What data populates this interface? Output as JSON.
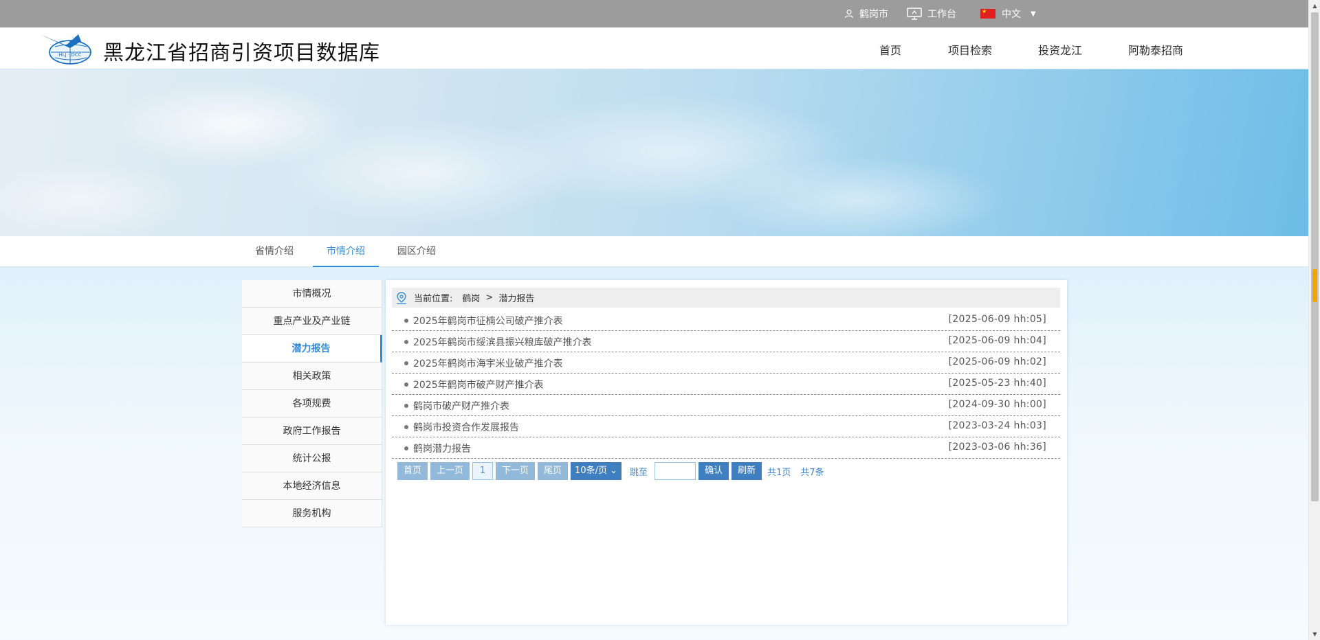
{
  "topbar": {
    "user_label": "鹤岗市",
    "workbench_label": "工作台",
    "language_label": "中文"
  },
  "header": {
    "site_title": "黑龙江省招商引资项目数据库",
    "logo_text": "HLJ · DCC",
    "nav": [
      "首页",
      "项目检索",
      "投资龙江",
      "阿勒泰招商"
    ]
  },
  "subtabs": [
    "省情介绍",
    "市情介绍",
    "园区介绍"
  ],
  "sidebar": {
    "items": [
      "市情概况",
      "重点产业及产业链",
      "潜力报告",
      "相关政策",
      "各项规费",
      "政府工作报告",
      "统计公报",
      "本地经济信息",
      "服务机构"
    ],
    "active": "潜力报告"
  },
  "breadcrumb": {
    "prefix": "当前位置:",
    "city": "鹤岗",
    "separator": ">",
    "page": "潜力报告"
  },
  "articles": [
    {
      "title": "2025年鹤岗市征楠公司破产推介表",
      "date": "[2025-06-09 hh:05]"
    },
    {
      "title": "2025年鹤岗市绥滨县振兴粮库破产推介表",
      "date": "[2025-06-09 hh:04]"
    },
    {
      "title": "2025年鹤岗市海宇米业破产推介表",
      "date": "[2025-06-09 hh:02]"
    },
    {
      "title": "2025年鹤岗市破产财产推介表",
      "date": "[2025-05-23 hh:40]"
    },
    {
      "title": "鹤岗市破产财产推介表",
      "date": "[2024-09-30 hh:00]"
    },
    {
      "title": "鹤岗市投资合作发展报告",
      "date": "[2023-03-24 hh:03]"
    },
    {
      "title": "鹤岗潜力报告",
      "date": "[2023-03-06 hh:36]"
    }
  ],
  "pager": {
    "first": "首页",
    "prev": "上一页",
    "current": "1",
    "next": "下一页",
    "last": "尾页",
    "page_size": "10条/页",
    "jump_label": "跳至",
    "jump_value": "",
    "confirm": "确认",
    "refresh": "刷新",
    "total_pages": "共1页",
    "total_items": "共7条"
  },
  "colors": {
    "accent": "#2f8ad8",
    "topbar_bg": "#9c9c9c",
    "pager_dark": "#3f7fc0",
    "pager_light": "#92b8da"
  }
}
